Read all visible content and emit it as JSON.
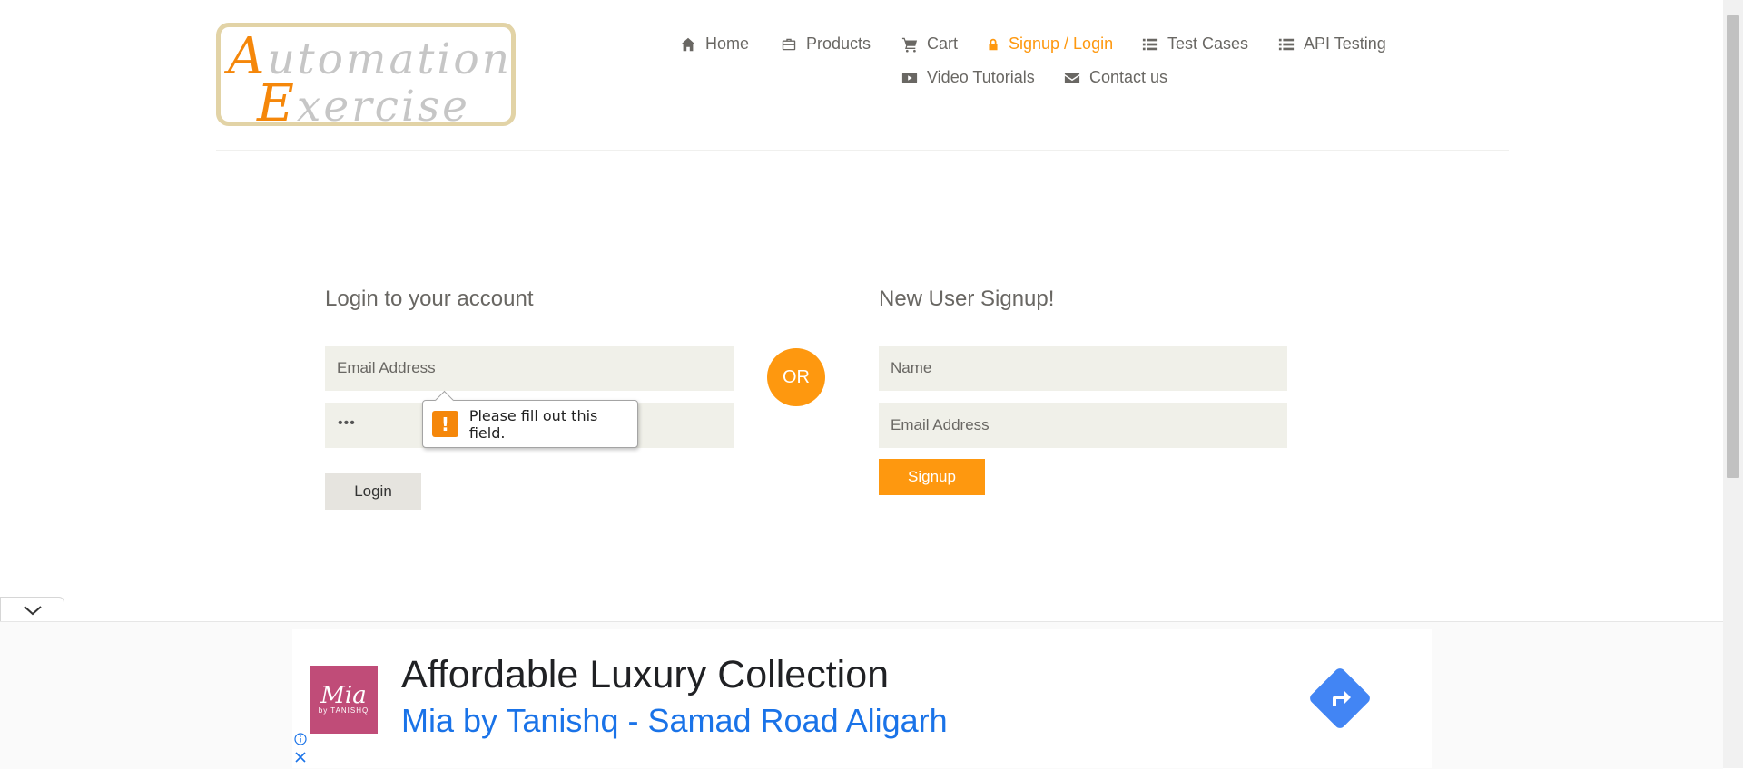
{
  "brand": {
    "logo_line1_cap": "A",
    "logo_line1_rest": "utomation",
    "logo_line2_cap": "E",
    "logo_line2_rest": "xercise"
  },
  "nav": {
    "items": [
      {
        "label": "Home",
        "icon": "home-icon"
      },
      {
        "label": "Products",
        "icon": "briefcase-icon"
      },
      {
        "label": "Cart",
        "icon": "cart-icon"
      },
      {
        "label": "Signup / Login",
        "icon": "lock-icon",
        "active": true
      },
      {
        "label": "Test Cases",
        "icon": "list-icon"
      },
      {
        "label": "API Testing",
        "icon": "list-icon"
      },
      {
        "label": "Video Tutorials",
        "icon": "youtube-icon"
      },
      {
        "label": "Contact us",
        "icon": "envelope-icon"
      }
    ]
  },
  "login": {
    "title": "Login to your account",
    "email_placeholder": "Email Address",
    "password_value": "•••",
    "button_label": "Login"
  },
  "or_label": "OR",
  "signup": {
    "title": "New User Signup!",
    "name_placeholder": "Name",
    "email_placeholder": "Email Address",
    "button_label": "Signup"
  },
  "validation": {
    "icon": "!",
    "message": "Please fill out this field."
  },
  "ad": {
    "logo_text": "Mia",
    "logo_sub": "by TANISHQ",
    "title": "Affordable Luxury Collection",
    "subtitle": "Mia by Tanishq - Samad Road Aligarh"
  },
  "colors": {
    "accent": "#FE980F",
    "field_bg": "#F0F0E9",
    "text": "#696763",
    "ad_link": "#1a73e8"
  }
}
